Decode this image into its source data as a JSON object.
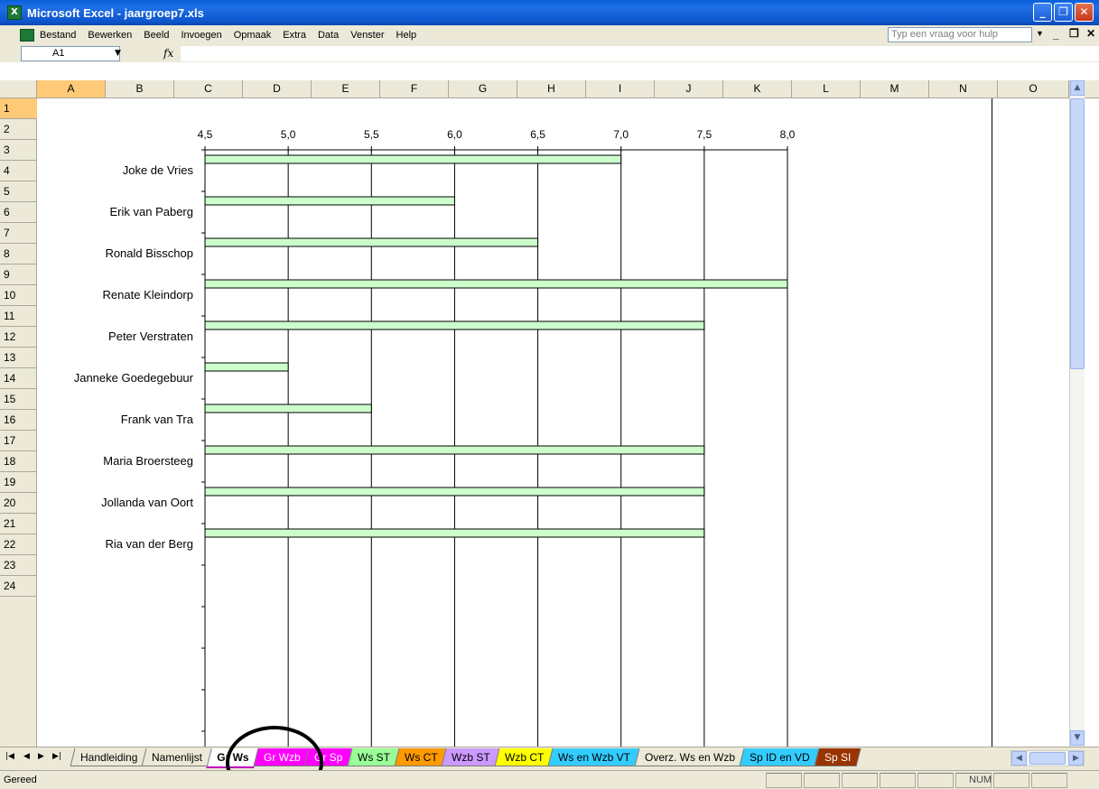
{
  "window": {
    "title": "Microsoft Excel - jaargroep7.xls",
    "buttons": [
      "_",
      "❐",
      "✕"
    ]
  },
  "menu": {
    "items": [
      "Bestand",
      "Bewerken",
      "Beeld",
      "Invoegen",
      "Opmaak",
      "Extra",
      "Data",
      "Venster",
      "Help"
    ],
    "help_placeholder": "Typ een vraag voor hulp"
  },
  "formula_bar": {
    "name_box": "A1",
    "fx": "fx",
    "value": ""
  },
  "columns": [
    "A",
    "B",
    "C",
    "D",
    "E",
    "F",
    "G",
    "H",
    "I",
    "J",
    "K",
    "L",
    "M",
    "N",
    "O"
  ],
  "rows": [
    "1",
    "2",
    "3",
    "4",
    "5",
    "6",
    "7",
    "8",
    "9",
    "10",
    "11",
    "12",
    "13",
    "14",
    "15",
    "16",
    "17",
    "18",
    "19",
    "20",
    "21",
    "22",
    "23",
    "24"
  ],
  "chart_data": {
    "type": "bar",
    "orientation": "horizontal",
    "xlim": [
      4.5,
      8.0
    ],
    "x_ticks": [
      "4,5",
      "5,0",
      "5,5",
      "6,0",
      "6,5",
      "7,0",
      "7,5",
      "8,0"
    ],
    "categories": [
      "Joke de Vries",
      "Erik van Paberg",
      "Ronald Bisschop",
      "Renate Kleindorp",
      "Peter Verstraten",
      "Janneke Goedegebuur",
      "Frank van Tra",
      "Maria Broersteeg",
      "Jollanda van Oort",
      "Ria van der Berg"
    ],
    "values": [
      7.0,
      6.0,
      6.5,
      8.0,
      7.5,
      5.0,
      5.5,
      7.5,
      7.5,
      7.5
    ],
    "bar_color": "#ccffcc",
    "grid": true,
    "axis_position": "top"
  },
  "sheet_tabs": [
    {
      "label": "Handleiding",
      "color": "#ece9d8"
    },
    {
      "label": "Namenlijst",
      "color": "#ece9d8"
    },
    {
      "label": "Gr Ws",
      "color": "#ffffff",
      "active": true
    },
    {
      "label": "Gr Wzb",
      "color": "#ff00ff"
    },
    {
      "label": "Gr Sp",
      "color": "#ff00ff"
    },
    {
      "label": "Ws ST",
      "color": "#99ff99"
    },
    {
      "label": "Ws CT",
      "color": "#ff9900"
    },
    {
      "label": "Wzb ST",
      "color": "#cc99ff"
    },
    {
      "label": "Wzb CT",
      "color": "#ffff00"
    },
    {
      "label": "Ws en Wzb VT",
      "color": "#33ccff"
    },
    {
      "label": "Overz. Ws en Wzb",
      "color": "#ece9d8"
    },
    {
      "label": "Sp ID en VD",
      "color": "#33ccff"
    },
    {
      "label": "Sp SI",
      "color": "#993300"
    }
  ],
  "status": {
    "left": "Gereed",
    "num": "NUM"
  }
}
